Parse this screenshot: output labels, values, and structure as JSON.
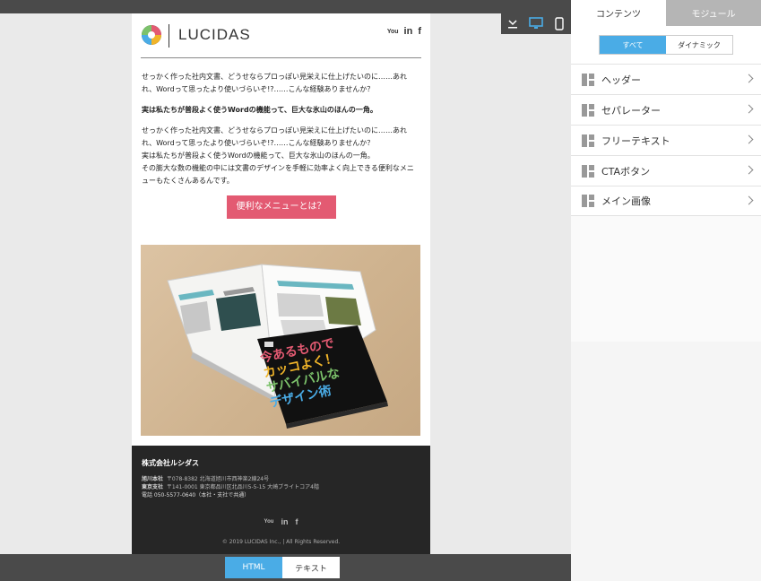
{
  "email": {
    "logo_text": "LUCIDAS",
    "social": [
      "You",
      "in",
      "f"
    ],
    "paragraph1": "せっかく作った社内文書、どうせならプロっぽい見栄えに仕上げたいのに……あれれ、Wordって思ったより使いづらいぞ!?……こんな経験ありませんか？",
    "paragraph2_bold": "実は私たちが普段よく使うWordの機能って、巨大な氷山のほんの一角。",
    "paragraph3_lines": [
      "せっかく作った社内文書、どうせならプロっぽい見栄えに仕上げたいのに……あれれ、Wordって思ったより使いづらいぞ!?……こんな経験ありませんか？",
      "実は私たちが普段よく使うWordの機能って、巨大な氷山のほんの一角。",
      "その膨大な数の機能の中には文書のデザインを手軽に効率よく向上できる便利なメニューもたくさんあるんです。"
    ],
    "cta_label": "便利なメニューとは？",
    "hero_text_lines": [
      "今あるもので",
      "カッコよく！",
      "サバイバルな",
      "デザイン術"
    ],
    "book_brand": "LUCIDAS",
    "footer": {
      "company": "株式会社ルシダス",
      "addr1_label": "旭川本社",
      "addr1": "〒078-8382 北海道旭川市西神楽2線24号",
      "addr2_label": "東京支社",
      "addr2": "〒141-0001 東京都品川区北品川5-5-15 大崎ブライトコア4階",
      "phone": "電話 050-5577-0640（本社・支社で共通）",
      "copyright": "© 2019 LUCIDAS Inc., | All Rights Reserved."
    }
  },
  "bottom": {
    "html_label": "HTML",
    "text_label": "テキスト"
  },
  "panel": {
    "tab_contents": "コンテンツ",
    "tab_modules": "モジュール",
    "filter_all": "すべて",
    "filter_dynamic": "ダイナミック",
    "modules": [
      "ヘッダー",
      "セパレーター",
      "フリーテキスト",
      "CTAボタン",
      "メイン画像"
    ]
  },
  "colors": {
    "accent": "#4aace6",
    "cta": "#e35a72",
    "footer": "#262626",
    "chrome": "#4a4a4a"
  }
}
